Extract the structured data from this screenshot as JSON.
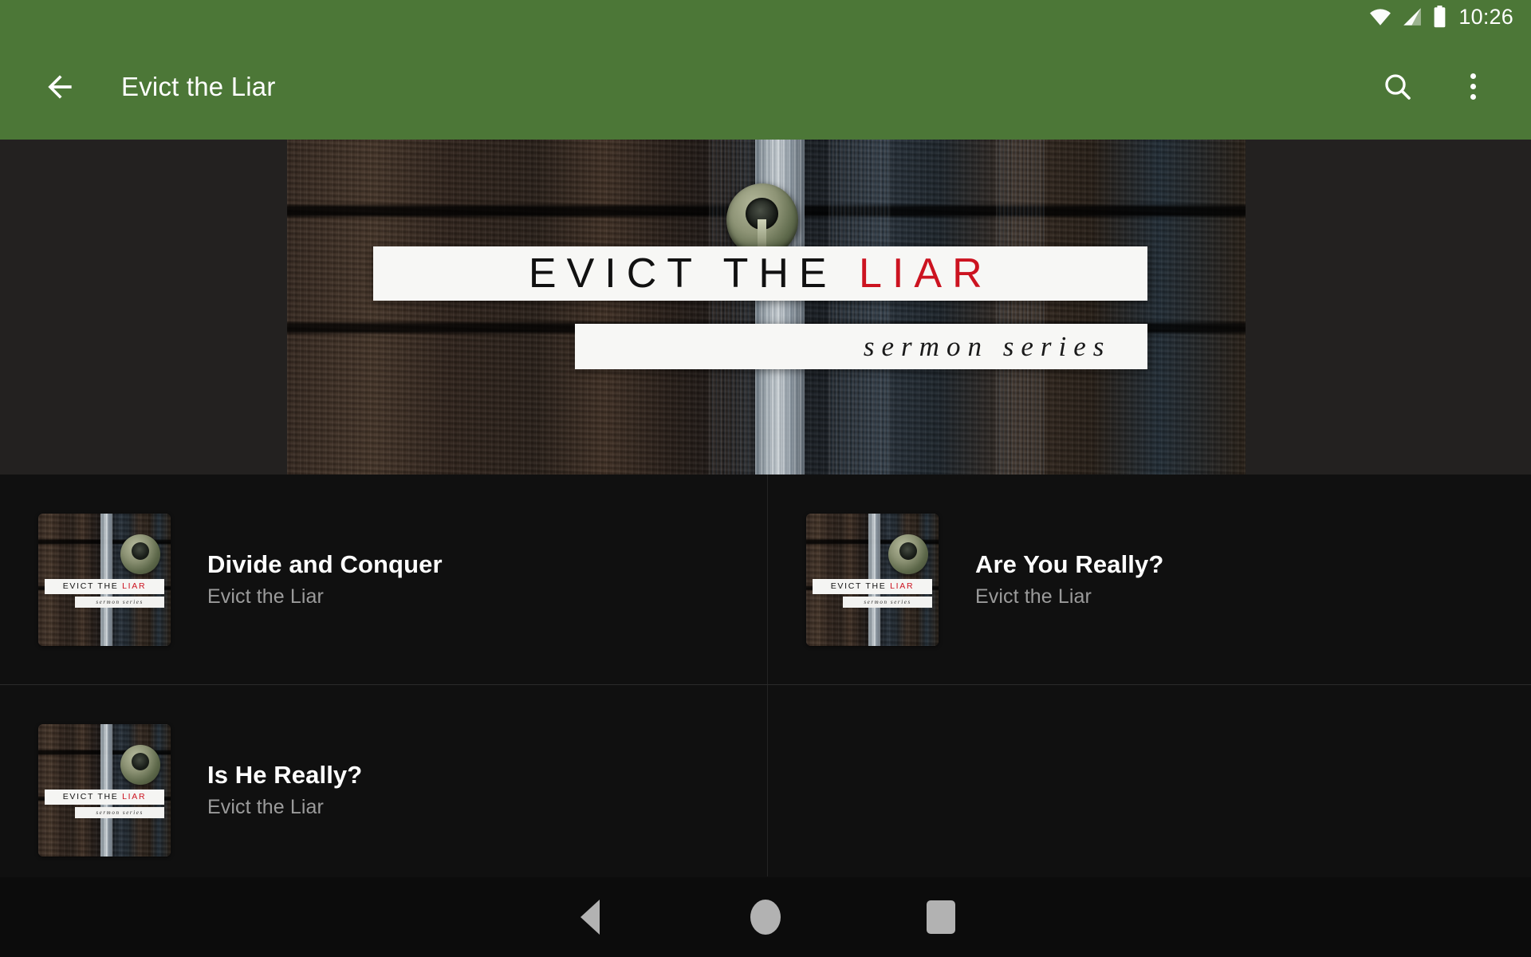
{
  "status_bar": {
    "clock": "10:26",
    "icons": [
      "wifi-icon",
      "cell-signal-icon",
      "battery-icon"
    ],
    "background_color": "#4c7737"
  },
  "app_bar": {
    "title": "Evict the Liar",
    "back_label": "back-arrow-icon",
    "search_label": "search-icon",
    "overflow_label": "more-options-icon",
    "background_color": "#4c7737",
    "text_color": "#ffffff"
  },
  "hero": {
    "title_part1": "EVICT THE ",
    "title_accent": "LIAR",
    "subtitle": "sermon series",
    "accent_color": "#cc1320",
    "banner_color": "#f7f7f5",
    "background_color": "#232120"
  },
  "list": {
    "items": [
      {
        "title": "Divide and Conquer",
        "subtitle": "Evict the Liar",
        "thumb_title": "EVICT THE ",
        "thumb_accent": "LIAR",
        "thumb_subtitle": "sermon series"
      },
      {
        "title": "Are You Really?",
        "subtitle": "Evict the Liar",
        "thumb_title": "EVICT THE ",
        "thumb_accent": "LIAR",
        "thumb_subtitle": "sermon series"
      },
      {
        "title": "Is He Really?",
        "subtitle": "Evict the Liar",
        "thumb_title": "EVICT THE ",
        "thumb_accent": "LIAR",
        "thumb_subtitle": "sermon series"
      }
    ],
    "background_color": "#101010",
    "title_color": "#ffffff",
    "subtitle_color": "#9b9b9b"
  },
  "nav_bar": {
    "back_label": "nav-back-icon",
    "home_label": "nav-home-icon",
    "recents_label": "nav-recents-icon",
    "background_color": "#0c0c0c"
  }
}
